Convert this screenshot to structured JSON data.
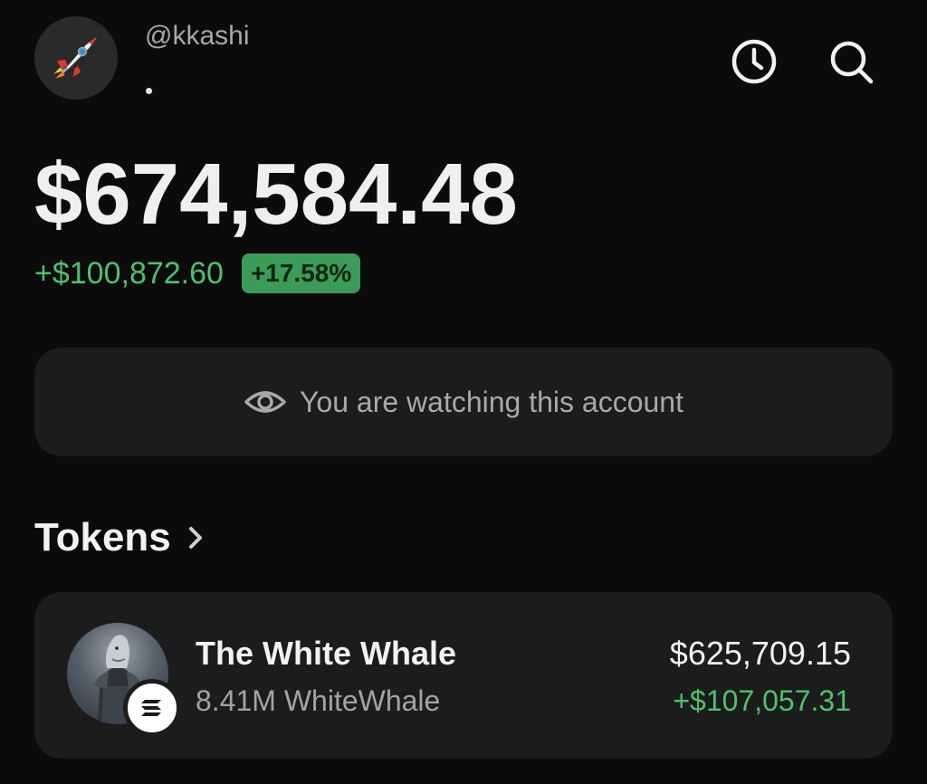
{
  "header": {
    "avatar_icon": "rocket-icon",
    "handle": "@kkashi",
    "history_icon": "clock-icon",
    "search_icon": "search-icon"
  },
  "balance": {
    "total": "$674,584.48",
    "change_amount": "+$100,872.60",
    "change_percent": "+17.58%"
  },
  "watch_notice": {
    "icon": "eye-icon",
    "text": "You are watching this account"
  },
  "tokens": {
    "title": "Tokens",
    "chevron_icon": "chevron-right-icon",
    "items": [
      {
        "name": "The White Whale",
        "amount": "8.41M WhiteWhale",
        "value": "$625,709.15",
        "change": "+$107,057.31",
        "chain_icon": "solana-icon"
      }
    ]
  },
  "colors": {
    "background": "#0b0b0b",
    "card": "#1c1c1c",
    "positive": "#4cc26b",
    "badge": "#3a9c56",
    "muted_text": "#a8a8a8"
  }
}
